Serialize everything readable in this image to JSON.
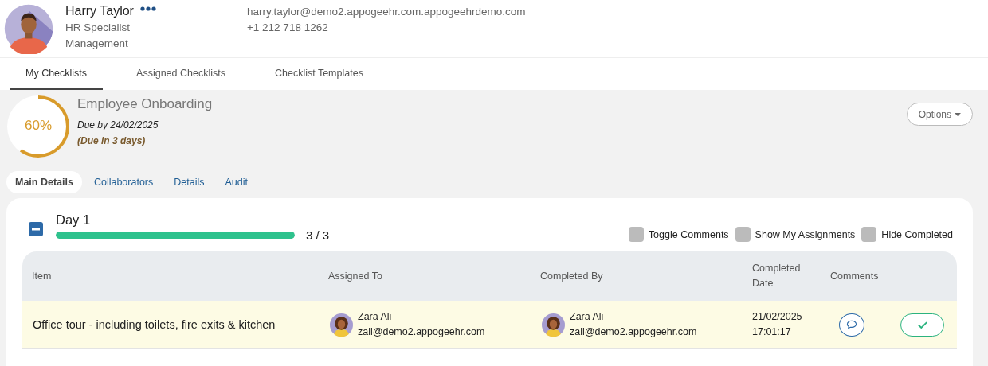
{
  "profile": {
    "name": "Harry Taylor",
    "title": "HR Specialist",
    "department": "Management",
    "email": "harry.taylor@demo2.appogeehr.com.appogeehrdemo.com",
    "phone": "+1 212 718 1262"
  },
  "tabs": [
    {
      "label": "My Checklists",
      "selected": true
    },
    {
      "label": "Assigned Checklists",
      "selected": false
    },
    {
      "label": "Checklist Templates",
      "selected": false
    }
  ],
  "checklist": {
    "percent": "60%",
    "title": "Employee Onboarding",
    "due": "Due by 24/02/2025",
    "due_note": "(Due in 3 days)",
    "options_button": "Options"
  },
  "sub_tabs": [
    {
      "label": "Main Details",
      "selected": true
    },
    {
      "label": "Collaborators",
      "selected": false
    },
    {
      "label": "Details",
      "selected": false
    },
    {
      "label": "Audit",
      "selected": false
    }
  ],
  "section": {
    "title": "Day 1",
    "expanded": true,
    "level": 1,
    "count": "3 / 3",
    "toggles": [
      {
        "label": "Toggle Comments",
        "checked": false
      },
      {
        "label": "Show My Assignments",
        "checked": false
      },
      {
        "label": "Hide Completed",
        "checked": false
      }
    ],
    "columns": [
      "Item",
      "Assigned To",
      "Completed By",
      "Completed Date",
      "Comments"
    ],
    "rows": [
      {
        "item": "Office tour - including toilets, fire exits & kitchen",
        "highlighted": true,
        "assigned_to": {
          "name": "Zara Ali",
          "email": "zali@demo2.appogeehr.com"
        },
        "completed_by": {
          "name": "Zara Ali",
          "email": "zali@demo2.appogeehr.com"
        },
        "completed_date": "21/02/2025",
        "completed_time": "17:01:17",
        "completed": true
      }
    ]
  }
}
